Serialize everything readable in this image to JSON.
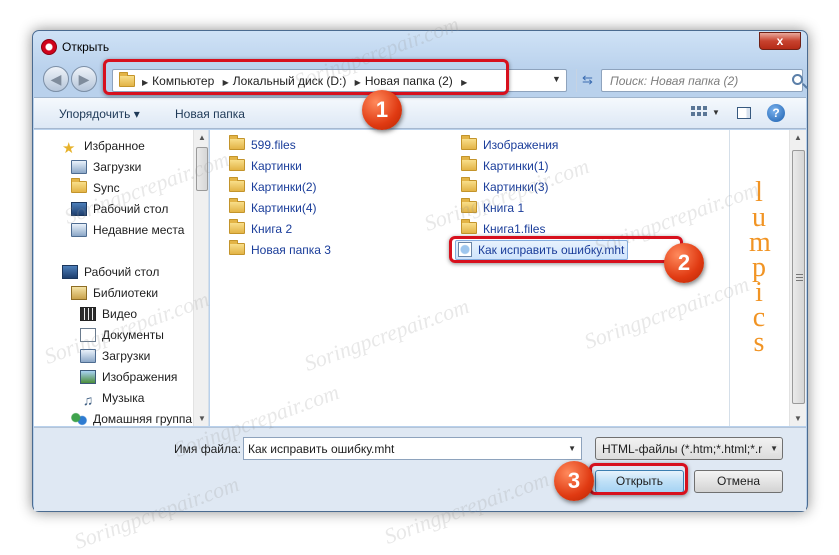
{
  "window": {
    "title": "Открыть",
    "close_label": "x"
  },
  "address": {
    "crumbs": [
      "Компьютер",
      "Локальный диск (D:)",
      "Новая папка (2)"
    ],
    "search_placeholder": "Поиск: Новая папка (2)"
  },
  "toolbar": {
    "organize_label": "Упорядочить ▾",
    "new_folder_label": "Новая папка"
  },
  "navpane": {
    "items": [
      {
        "label": "Избранное",
        "icon": "star-icon"
      },
      {
        "label": "Загрузки",
        "icon": "downloads-icon"
      },
      {
        "label": "Sync",
        "icon": "folder-icon"
      },
      {
        "label": "Рабочий стол",
        "icon": "desktop-icon"
      },
      {
        "label": "Недавние места",
        "icon": "recent-places-icon"
      },
      {
        "label": "Рабочий стол",
        "icon": "desktop-icon"
      },
      {
        "label": "Библиотеки",
        "icon": "libraries-icon"
      },
      {
        "label": "Видео",
        "icon": "video-icon"
      },
      {
        "label": "Документы",
        "icon": "documents-icon"
      },
      {
        "label": "Загрузки",
        "icon": "downloads-icon"
      },
      {
        "label": "Изображения",
        "icon": "pictures-icon"
      },
      {
        "label": "Музыка",
        "icon": "music-icon"
      },
      {
        "label": "Домашняя группа",
        "icon": "homegroup-icon"
      }
    ]
  },
  "files": {
    "col1": [
      "599.files",
      "Картинки",
      "Картинки(2)",
      "Картинки(4)",
      "Книга 2",
      "Новая папка 3"
    ],
    "col2": [
      "Изображения",
      "Картинки(1)",
      "Картинки(3)",
      "Книга 1",
      "Книга1.files"
    ],
    "selected_file": "Как исправить ошибку.mht"
  },
  "preview_letters": [
    "l",
    "u",
    "m",
    "p",
    "i",
    "c",
    "s"
  ],
  "bottom": {
    "filename_label": "Имя файла:",
    "filename_value": "Как исправить ошибку.mht",
    "filter_value": "HTML-файлы (*.htm;*.html;*.r",
    "open_label": "Открыть",
    "cancel_label": "Отмена"
  },
  "annotations": {
    "badge1": "1",
    "badge2": "2",
    "badge3": "3",
    "accent_color": "#d7101d"
  },
  "watermark": "Soringpcrepair.com"
}
